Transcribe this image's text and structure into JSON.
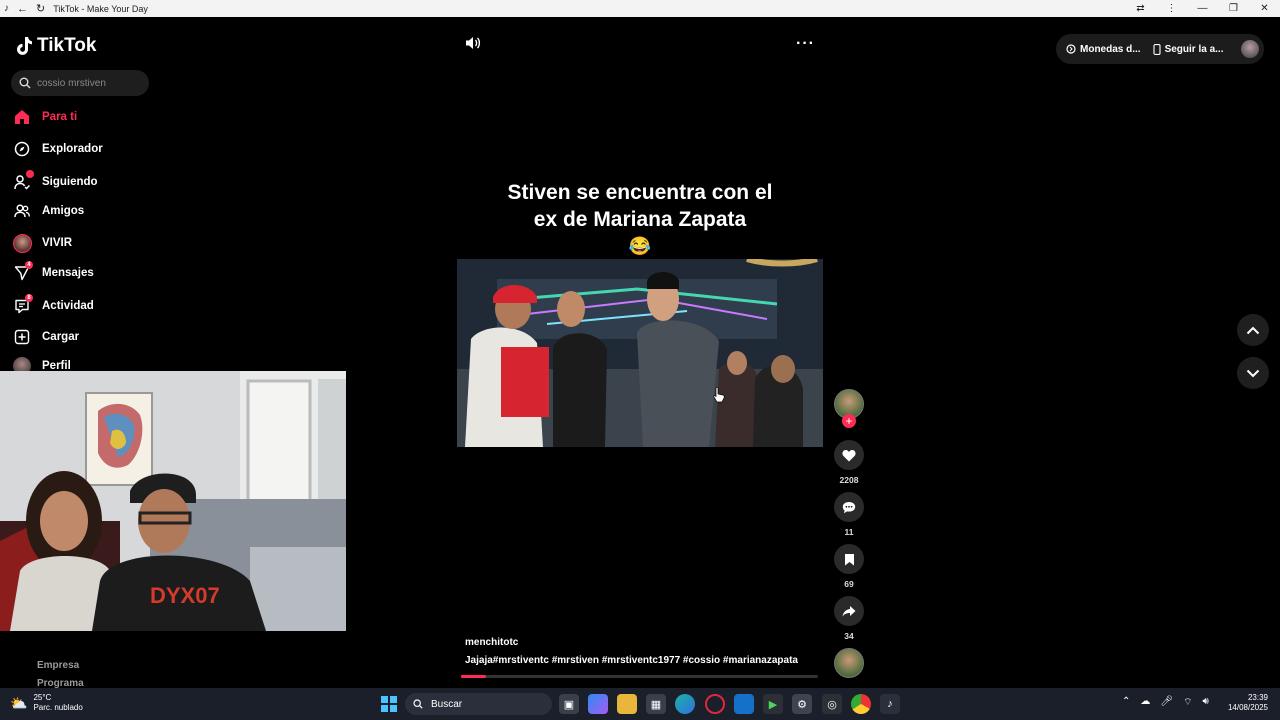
{
  "window": {
    "title": "TikTok - Make Your Day",
    "controls": [
      "—",
      "❐",
      "✕"
    ]
  },
  "brand": {
    "name": "TikTok",
    "accent": "#fe2c55"
  },
  "search": {
    "value": "cossio mrstiven"
  },
  "sidebar": {
    "items": [
      {
        "label": "Para ti",
        "icon": "home-icon",
        "active": true
      },
      {
        "label": "Explorador",
        "icon": "compass-icon"
      },
      {
        "label": "Siguiendo",
        "icon": "following-icon"
      },
      {
        "label": "Amigos",
        "icon": "friends-icon"
      },
      {
        "label": "VIVIR",
        "icon": "live-avatar-icon"
      },
      {
        "label": "Mensajes",
        "icon": "messages-icon",
        "badge": "4"
      },
      {
        "label": "Actividad",
        "icon": "activity-icon",
        "badge": "8"
      },
      {
        "label": "Cargar",
        "icon": "upload-icon"
      },
      {
        "label": "Perfil",
        "icon": "profile-avatar-icon"
      }
    ],
    "footer": [
      "Empresa",
      "Programa"
    ]
  },
  "topbar": {
    "coins_label": "Monedas d...",
    "follow_app_label": "Seguir la a..."
  },
  "video": {
    "title_line1": "Stiven se encuentra con el",
    "title_line2": "ex de Mariana Zapata",
    "title_emoji": "😂",
    "author": "menchitotc",
    "caption": "Jajaja#mrstiventc  #mrstiven  #mrstiventc1977  #cossio  #marianazapata",
    "progress_fraction": 0.07
  },
  "actions": {
    "likes": "2208",
    "comments": "11",
    "saves": "69",
    "shares": "34"
  },
  "taskbar": {
    "weather_temp": "25°C",
    "weather_desc": "Parc. nublado",
    "search_label": "Buscar",
    "time": "23:39",
    "date": "14/08/2025"
  }
}
